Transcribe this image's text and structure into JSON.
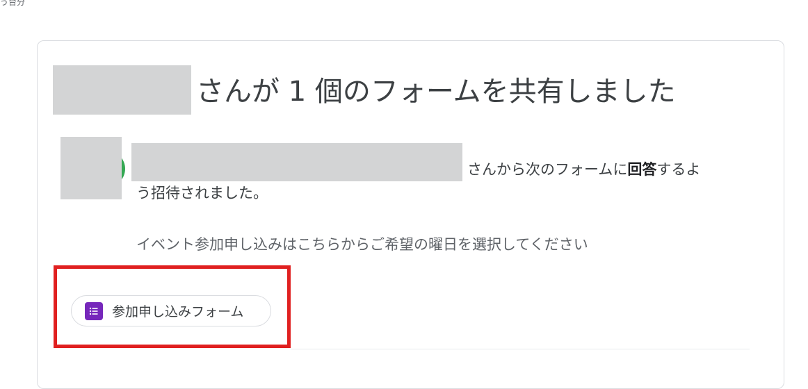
{
  "page": {
    "top_fragment": "う台分",
    "heading_suffix": "さんが 1 個のフォームを共有しました",
    "invite_line1_prefix": "さんから次のフォームに",
    "invite_line1_bold": "回答",
    "invite_line1_suffix": "するよ",
    "invite_line2": "う招待されました。",
    "description": "イベント参加申し込みはこちらからご希望の曜日を選択してください",
    "form_chip_label": "参加申し込みフォーム",
    "form_icon": "google-forms-icon"
  },
  "colors": {
    "form_icon": "#7627bb",
    "highlight": "#e02020",
    "redaction": "#d3d4d5"
  }
}
